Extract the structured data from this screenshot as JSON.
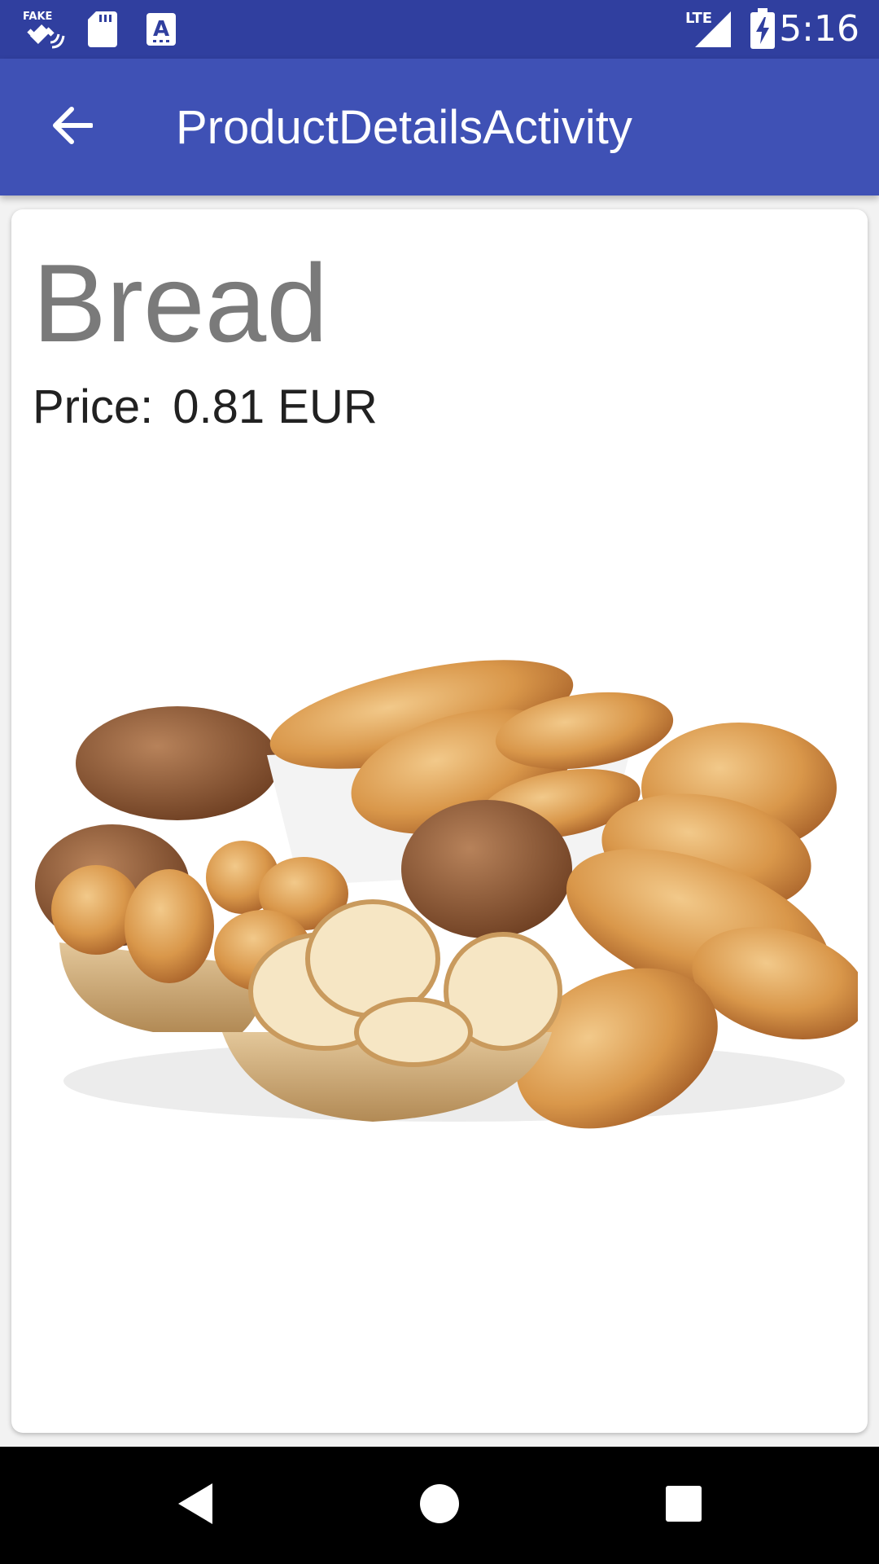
{
  "status_bar": {
    "time": "5:16",
    "network": "LTE",
    "left_icons": [
      "fake-gps-icon",
      "sd-card-icon",
      "text-a-icon"
    ],
    "right_icons": [
      "lte-signal-icon",
      "battery-charging-icon"
    ]
  },
  "app_bar": {
    "title": "ProductDetailsActivity",
    "back_icon": "arrow-back-icon"
  },
  "product": {
    "name": "Bread",
    "price_label": "Price:",
    "price_value": "0.81 EUR",
    "image": "bread-assortment-photo"
  },
  "nav_bar": {
    "buttons": [
      "back-triangle-icon",
      "home-circle-icon",
      "recents-square-icon"
    ]
  },
  "colors": {
    "status_bar": "#303f9f",
    "app_bar": "#3f51b5",
    "product_name": "#7a7a7a",
    "price_text": "#212121"
  }
}
